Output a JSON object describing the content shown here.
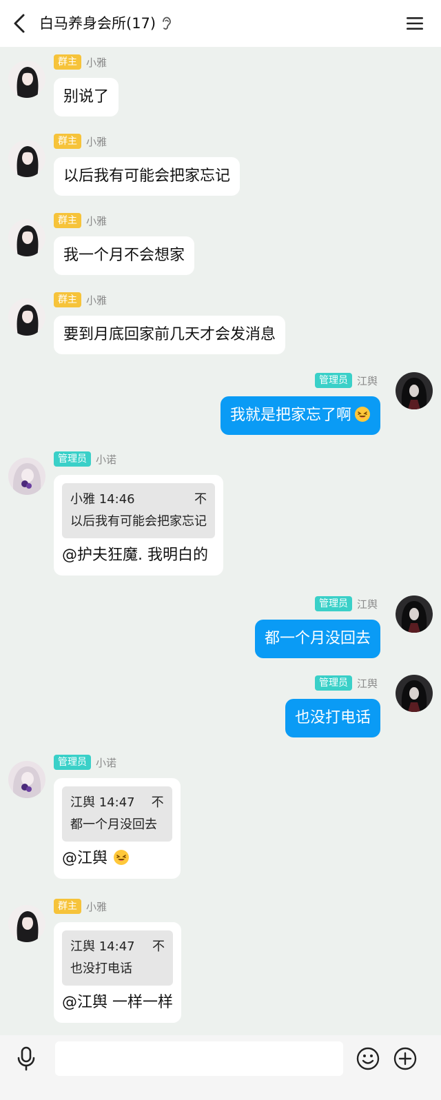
{
  "header": {
    "title": "白马养身会所(17)",
    "back_icon": "back-arrow-icon",
    "ear_icon": "ear-icon",
    "menu_icon": "menu-icon"
  },
  "messages": [
    {
      "side": "left",
      "badge": "群主",
      "sender": "小雅",
      "text": "别说了"
    },
    {
      "side": "left",
      "badge": "群主",
      "sender": "小雅",
      "text": "以后我有可能会把家忘记"
    },
    {
      "side": "left",
      "badge": "群主",
      "sender": "小雅",
      "text": "我一个月不会想家"
    },
    {
      "side": "left",
      "badge": "群主",
      "sender": "小雅",
      "text": "要到月底回家前几天才会发消息"
    },
    {
      "side": "right",
      "badge": "管理员",
      "sender": "江舆",
      "text": "我就是把家忘了啊"
    },
    {
      "side": "left",
      "badge": "管理员",
      "sender": "小诺",
      "quote_head": "小雅 14:46",
      "quote_text": "以后我有可能会把家忘记",
      "text": "@护夫狂魔. 我明白的"
    },
    {
      "side": "right",
      "badge": "管理员",
      "sender": "江舆",
      "text": "都一个月没回去"
    },
    {
      "side": "right",
      "badge": "管理员",
      "sender": "江舆",
      "text": "也没打电话"
    },
    {
      "side": "left",
      "badge": "管理员",
      "sender": "小诺",
      "quote_head": "江舆 14:47",
      "quote_text": "都一个月没回去",
      "text": "@江舆"
    },
    {
      "side": "left",
      "badge": "群主",
      "sender": "小雅",
      "quote_head": "江舆 14:47",
      "quote_text": "也没打电话",
      "text": "@江舆 一样一样"
    }
  ],
  "quote_pin": "不",
  "colors": {
    "owner_badge": "#f6c33a",
    "admin_badge": "#3ad0c8",
    "self_bubble": "#0a9bf5",
    "background": "#edf1ee"
  },
  "input_bar": {
    "mic_icon": "mic-icon",
    "input_value": "",
    "emoji_icon": "smiley-icon",
    "plus_icon": "plus-circle-icon"
  }
}
